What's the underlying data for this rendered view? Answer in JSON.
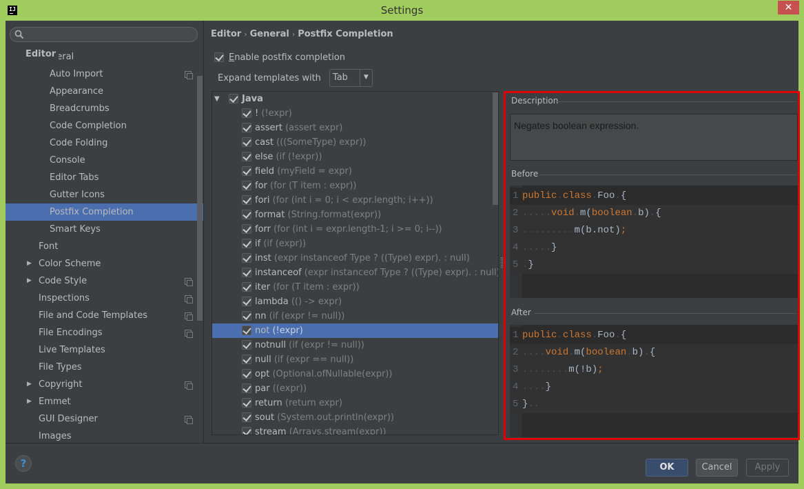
{
  "window": {
    "title": "Settings",
    "app_icon": "IJ",
    "close_glyph": "✕"
  },
  "sidebar": {
    "search": {
      "value": "",
      "placeholder": ""
    },
    "header": "Editor",
    "items": [
      {
        "label": "General",
        "level": 1,
        "arrow": "down"
      },
      {
        "label": "Auto Import",
        "level": 2,
        "project": true
      },
      {
        "label": "Appearance",
        "level": 2
      },
      {
        "label": "Breadcrumbs",
        "level": 2
      },
      {
        "label": "Code Completion",
        "level": 2
      },
      {
        "label": "Code Folding",
        "level": 2
      },
      {
        "label": "Console",
        "level": 2
      },
      {
        "label": "Editor Tabs",
        "level": 2
      },
      {
        "label": "Gutter Icons",
        "level": 2
      },
      {
        "label": "Postfix Completion",
        "level": 2,
        "selected": true
      },
      {
        "label": "Smart Keys",
        "level": 2
      },
      {
        "label": "Font",
        "level": 1
      },
      {
        "label": "Color Scheme",
        "level": 1,
        "arrow": "right"
      },
      {
        "label": "Code Style",
        "level": 1,
        "arrow": "right",
        "project": true
      },
      {
        "label": "Inspections",
        "level": 1,
        "project": true
      },
      {
        "label": "File and Code Templates",
        "level": 1,
        "project": true
      },
      {
        "label": "File Encodings",
        "level": 1,
        "project": true
      },
      {
        "label": "Live Templates",
        "level": 1
      },
      {
        "label": "File Types",
        "level": 1
      },
      {
        "label": "Copyright",
        "level": 1,
        "arrow": "right",
        "project": true
      },
      {
        "label": "Emmet",
        "level": 1,
        "arrow": "right"
      },
      {
        "label": "GUI Designer",
        "level": 1,
        "project": true
      },
      {
        "label": "Images",
        "level": 1
      }
    ]
  },
  "main": {
    "breadcrumb": [
      "Editor",
      "General",
      "Postfix Completion"
    ],
    "breadcrumb_sep": "›",
    "enable": {
      "label_mnemonic": "E",
      "label_rest": "nable postfix completion",
      "checked": true
    },
    "expand": {
      "label": "Expand templates with",
      "value": "Tab"
    },
    "group": {
      "label": "Java",
      "checked": true
    },
    "templates": [
      {
        "key": "!",
        "desc": "(!expr)",
        "checked": true
      },
      {
        "key": "assert",
        "desc": "(assert expr)",
        "checked": true
      },
      {
        "key": "cast",
        "desc": "(((SomeType) expr))",
        "checked": true
      },
      {
        "key": "else",
        "desc": "(if (!expr))",
        "checked": true
      },
      {
        "key": "field",
        "desc": "(myField = expr)",
        "checked": true
      },
      {
        "key": "for",
        "desc": "(for (T item : expr))",
        "checked": true
      },
      {
        "key": "fori",
        "desc": "(for (int i = 0; i < expr.length; i++))",
        "checked": true
      },
      {
        "key": "format",
        "desc": "(String.format(expr))",
        "checked": true
      },
      {
        "key": "forr",
        "desc": "(for (int i = expr.length-1; i >= 0; i--))",
        "checked": true
      },
      {
        "key": "if",
        "desc": "(if (expr))",
        "checked": true
      },
      {
        "key": "inst",
        "desc": "(expr instanceof Type ? ((Type) expr). : null)",
        "checked": true
      },
      {
        "key": "instanceof",
        "desc": "(expr instanceof Type ? ((Type) expr). : null)",
        "checked": true
      },
      {
        "key": "iter",
        "desc": "(for (T item : expr))",
        "checked": true
      },
      {
        "key": "lambda",
        "desc": "(() -> expr)",
        "checked": true
      },
      {
        "key": "nn",
        "desc": "(if (expr != null))",
        "checked": true
      },
      {
        "key": "not",
        "desc": "(!expr)",
        "checked": true,
        "selected": true
      },
      {
        "key": "notnull",
        "desc": "(if (expr != null))",
        "checked": true
      },
      {
        "key": "null",
        "desc": "(if (expr == null))",
        "checked": true
      },
      {
        "key": "opt",
        "desc": "(Optional.ofNullable(expr))",
        "checked": true
      },
      {
        "key": "par",
        "desc": "((expr))",
        "checked": true
      },
      {
        "key": "return",
        "desc": "(return expr)",
        "checked": true
      },
      {
        "key": "sout",
        "desc": "(System.out.println(expr))",
        "checked": true
      },
      {
        "key": "stream",
        "desc": "(Arrays.stream(expr))",
        "checked": true
      }
    ]
  },
  "details": {
    "description_title": "Description",
    "description": "Negates boolean expression.",
    "before_title": "Before",
    "after_title": "After",
    "before_code": [
      [
        [
          "kw",
          "public"
        ],
        [
          "dot",
          "."
        ],
        [
          "kw",
          "class"
        ],
        [
          "dot",
          "."
        ],
        [
          "t",
          "Foo"
        ],
        [
          "dot",
          "."
        ],
        [
          "t",
          "{"
        ]
      ],
      [
        [
          "dot",
          "....."
        ],
        [
          "kw",
          "void"
        ],
        [
          "dot",
          "."
        ],
        [
          "t",
          "m("
        ],
        [
          "kw",
          "boolean"
        ],
        [
          "dot",
          "."
        ],
        [
          "t",
          "b)"
        ],
        [
          "dot",
          "."
        ],
        [
          "t",
          "{"
        ]
      ],
      [
        [
          "dot",
          "........."
        ],
        [
          "t",
          "m(b.not)"
        ],
        [
          "kw",
          ";"
        ]
      ],
      [
        [
          "dot",
          "....."
        ],
        [
          "t",
          "}"
        ]
      ],
      [
        [
          "dot",
          "."
        ],
        [
          "t",
          "}"
        ]
      ]
    ],
    "after_code": [
      [
        [
          "kw",
          "public"
        ],
        [
          "dot",
          "."
        ],
        [
          "kw",
          "class"
        ],
        [
          "dot",
          "."
        ],
        [
          "t",
          "Foo"
        ],
        [
          "dot",
          "."
        ],
        [
          "t",
          "{"
        ]
      ],
      [
        [
          "dot",
          "...."
        ],
        [
          "kw",
          "void"
        ],
        [
          "dot",
          "."
        ],
        [
          "t",
          "m("
        ],
        [
          "kw",
          "boolean"
        ],
        [
          "dot",
          "."
        ],
        [
          "t",
          "b)"
        ],
        [
          "dot",
          "."
        ],
        [
          "t",
          "{"
        ]
      ],
      [
        [
          "dot",
          "........"
        ],
        [
          "t",
          "m(!b)"
        ],
        [
          "kw",
          ";"
        ]
      ],
      [
        [
          "dot",
          "...."
        ],
        [
          "t",
          "}"
        ]
      ],
      [
        [
          "t",
          "}"
        ],
        [
          "dot",
          ".."
        ]
      ]
    ]
  },
  "footer": {
    "help": "?",
    "ok": "OK",
    "cancel": "Cancel",
    "apply": "Apply"
  }
}
